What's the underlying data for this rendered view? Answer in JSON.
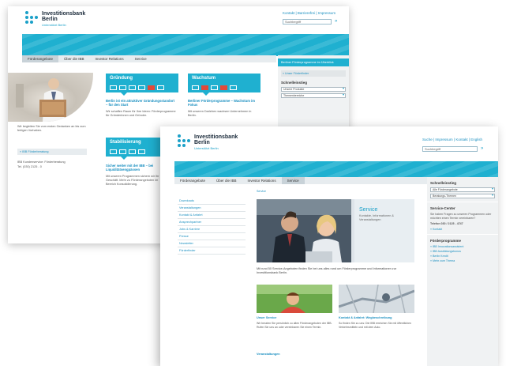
{
  "brand": {
    "line1": "Investitionsbank",
    "line2": "Berlin",
    "tagline": "Unterstützt Berlin"
  },
  "back_page": {
    "toplinks": "Kontakt | Barrierefrei | Impressum",
    "search_placeholder": "Suchbegriff",
    "nav": [
      "Förderangebote",
      "Über die IBB",
      "Investor Relations",
      "Service"
    ],
    "promos": [
      {
        "label": "Gründung",
        "heading": "Berlin ist ein attraktiver Gründungsstandort – für den Start",
        "text": "Wir schaffen Raum für Ihre Ideen: Förderprogramme für Gründerinnen und Gründer."
      },
      {
        "label": "Wachstum",
        "heading": "Berliner Förderprogramme – Wachstum im Fokus",
        "text": "Mit unseren Darlehen wachsen Unternehmen in Berlin."
      },
      {
        "label": "Stabilisierung",
        "heading": "Sicher weiter mit der IBB – bei Liquiditätsengpässen",
        "text": "Mit unseren Programmen sichern wir Ihr Geschäft. Mehr zu Förderangeboten im Bereich Konsolidierung."
      }
    ],
    "sidebar": {
      "promo": "Berliner Förderprogramme im Überblick",
      "contact": "» Unser Förderfinder",
      "title": "Schnelleinstieg",
      "select1": "Unsere Produkte",
      "select2": "Themenbereiche"
    },
    "left_caption": "Wir begleiten Sie vom ersten Gedanken an bis zum fertigen Vorhaben.",
    "left_link": "» IBB Förderberatung",
    "left_footer1": "IBB Kundenservice: Förderberatung",
    "left_footer2": "Tel. (030) 2125 - 0"
  },
  "front_page": {
    "toplinks": "Suche | Impressum | Kontakt | English",
    "search_placeholder": "Suchbegriff",
    "nav": [
      "Förderangebote",
      "Über die IBB",
      "Investor Relations",
      "Service"
    ],
    "active_nav": "Service",
    "breadcrumb": "Service",
    "left_menu": [
      "Downloads",
      "Veranstaltungen",
      "Kontakt & Anfahrt",
      "Ansprechpartner",
      "Jobs & Karriere",
      "Presse",
      "Newsletter",
      "Förderfinder"
    ],
    "hero": {
      "title": "Service",
      "subtitle": "Kontakte, Informationen & Veranstaltungen"
    },
    "intro": "Mit rund 50 Service-Angeboten finden Sie bei uns alles rund um Förderprogramme und Informationen zur Investitionsbank Berlin.",
    "columns": [
      {
        "heading": "Unser Service",
        "text": "Wir beraten Sie persönlich zu allen Förderangeboten der IBB. Rufen Sie uns an oder vereinbaren Sie einen Termin."
      },
      {
        "heading": "Kontakt & Anfahrt: Wegbeschreibung",
        "text": "So finden Sie zu uns: Die IBB erreichen Sie mit öffentlichen Verkehrsmitteln und mit dem Auto."
      }
    ],
    "bottom_heading": "Veranstaltungen",
    "sidebar": {
      "title": "Schnelleinstieg",
      "select1": "Alle Förderangebote",
      "select2": "Beratungs-Themen",
      "contact_title": "Service-Center",
      "contact_text": "Sie haben Fragen zu unseren Programmen oder möchten einen Termin vereinbaren?",
      "phone": "Telefon 030 / 2125 - 4747",
      "link1": "» Kontakt",
      "second_title": "Förderprogramme",
      "items": [
        "» IBB Innovationsassistent",
        "» IBB Ausbildungsbonus",
        "» Berlin Kredit",
        "» Mehr zum Thema"
      ]
    }
  }
}
